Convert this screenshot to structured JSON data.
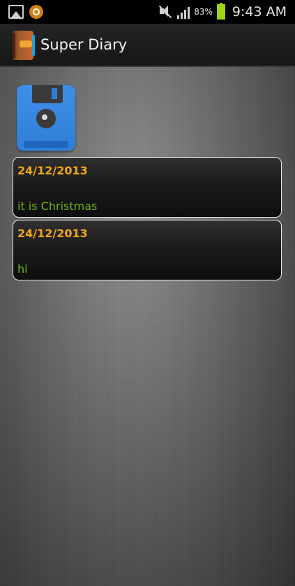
{
  "status_bar": {
    "battery_percent": "83%",
    "time": "9:43 AM",
    "icons": [
      "image-notification-icon",
      "app-notification-icon",
      "mute-icon",
      "signal-icon",
      "battery-icon"
    ],
    "battery_color": "#9fd318"
  },
  "action_bar": {
    "title": "Super Diary",
    "icon": "diary-book-icon"
  },
  "toolbar": {
    "save_icon": "floppy-disk-icon",
    "save_color": "#3f8ee6"
  },
  "entries": [
    {
      "date": "24/12/2013",
      "text": "it is Christmas"
    },
    {
      "date": "24/12/2013",
      "text": "hi"
    }
  ],
  "colors": {
    "date_color": "#f3a51b",
    "text_color": "#6fb521",
    "card_border": "#e9e9e9"
  }
}
